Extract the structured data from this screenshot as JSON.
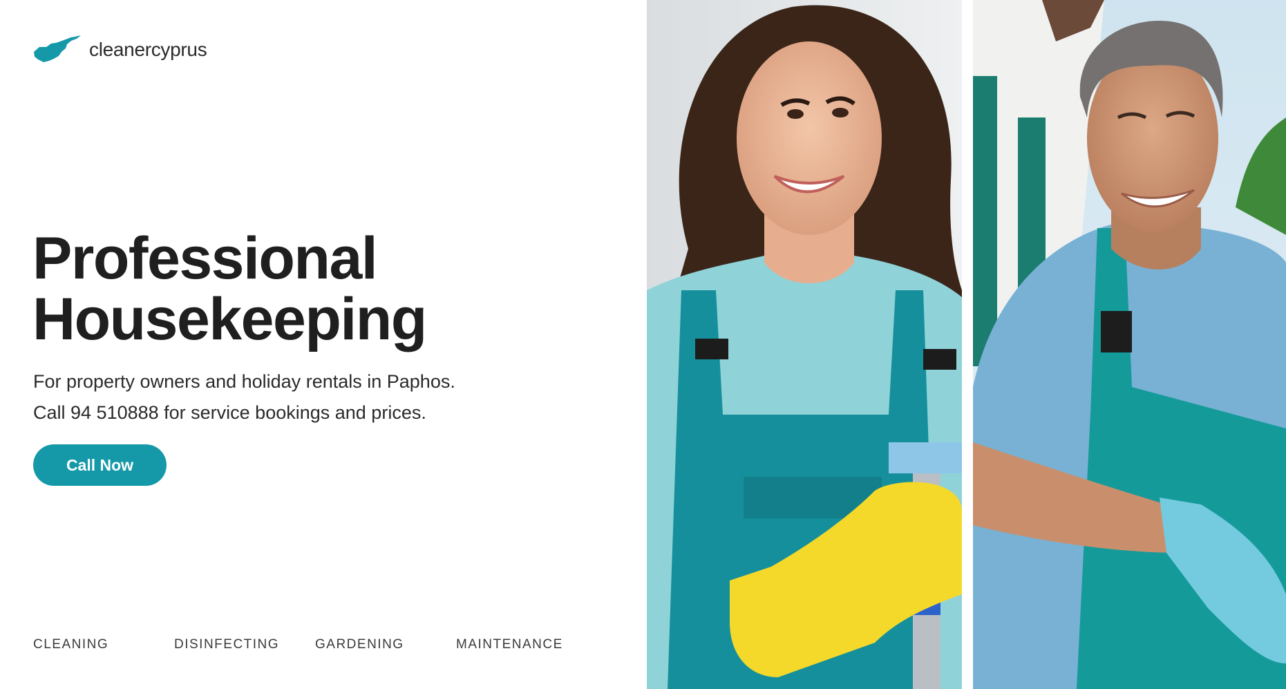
{
  "brand": {
    "name": "cleanercyprus",
    "logo_icon": "cyprus-map-icon",
    "accent_color": "#1599a8"
  },
  "hero": {
    "title_line1": "Professional",
    "title_line2": "Housekeeping",
    "subtitle_line1": "For property owners and holiday rentals in Paphos.",
    "subtitle_line2": "Call 94 510888 for service bookings and prices.",
    "cta_label": "Call Now"
  },
  "services": [
    {
      "label": "CLEANING"
    },
    {
      "label": "DISINFECTING"
    },
    {
      "label": "GARDENING"
    },
    {
      "label": "MAINTENANCE"
    }
  ],
  "photos": [
    {
      "name": "woman-cleaner-photo"
    },
    {
      "name": "man-gardener-photo"
    }
  ]
}
